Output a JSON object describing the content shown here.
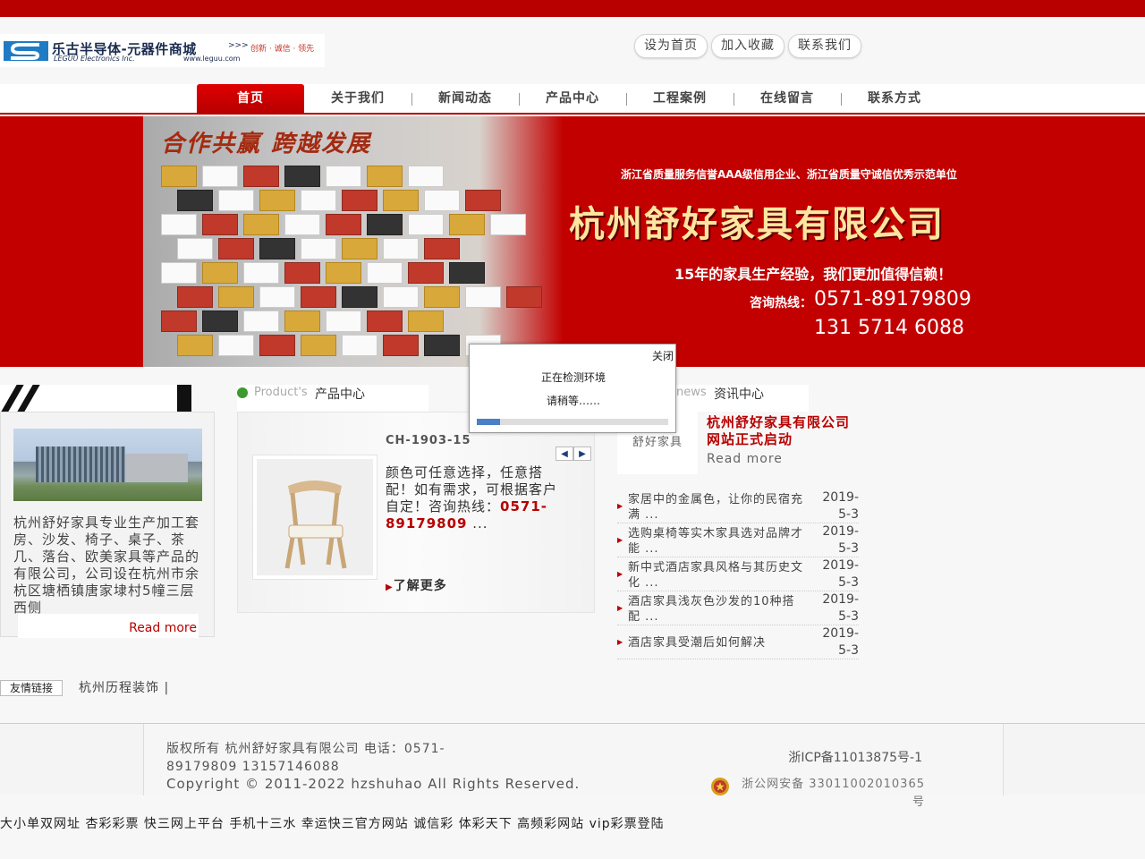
{
  "header": {
    "logo_name": "乐古半导体-元器件商城",
    "logo_arrows": ">>>",
    "logo_slogan": "创新 · 诚信 · 领先",
    "logo_sub": "LEGUU Electronics Inc.",
    "logo_url": "www.leguu.com",
    "links": [
      "设为首页",
      "加入收藏",
      "联系我们"
    ]
  },
  "nav": {
    "items": [
      "首页",
      "关于我们",
      "新闻动态",
      "产品中心",
      "工程案例",
      "在线留言",
      "联系方式"
    ],
    "active": "首页"
  },
  "banner": {
    "motto": "合作共赢 跨越发展",
    "cert": "浙江省质量服务信誉AAA级信用企业、浙江省质量守诚信优秀示范单位",
    "company": "杭州舒好家具有限公司",
    "experience": "15年的家具生产经验，我们更加值得信赖！",
    "hotline_label": "咨询热线：",
    "tel1": "0571-89179809",
    "tel2": "131 5714 6088"
  },
  "about": {
    "text": "杭州舒好家具专业生产加工套房、沙发、椅子、桌子、茶几、落台、欧美家具等产品的有限公司，公司设在杭州市余杭区塘栖镇唐家埭村5幢三层西侧",
    "more": "Read more"
  },
  "products": {
    "title_en": "Product's",
    "title_cn": "产品中心",
    "code": "CH-1903-15",
    "desc_plain": "颜色可任意选择，任意搭配！如有需求，可根据客户自定！咨询热线：",
    "desc_tel": "0571-89179809",
    "desc_ellipsis": " ...",
    "learn_more": "了解更多",
    "prev": "◀",
    "next": "▶"
  },
  "news": {
    "title_en": "news",
    "title_cn": "资讯中心",
    "badge": "舒好家具",
    "headline": "杭州舒好家具有限公司网站正式启动",
    "more": "Read more",
    "items": [
      {
        "title": "家居中的金属色，让你的民宿充满 ...",
        "date": "2019-5-3"
      },
      {
        "title": "选购桌椅等实木家具选对品牌才能 ...",
        "date": "2019-5-3"
      },
      {
        "title": "新中式酒店家具风格与其历史文化 ...",
        "date": "2019-5-3"
      },
      {
        "title": "酒店家具浅灰色沙发的10种搭配 ...",
        "date": "2019-5-3"
      },
      {
        "title": "酒店家具受潮后如何解决",
        "date": "2019-5-3"
      }
    ]
  },
  "friend_links": {
    "label": "友情链接",
    "text": "杭州历程装饰 |"
  },
  "footer": {
    "copy1": "版权所有 杭州舒好家具有限公司  电话：0571-89179809  13157146088",
    "copy2": "Copyright © 2011-2022 hzshuhao All Rights Reserved.",
    "icp": "浙ICP备11013875号-1",
    "gongan": "浙公网安备 33011002010365号"
  },
  "spam_links": "大小单双网址 杏彩彩票 快三网上平台 手机十三水 幸运快三官方网站 诚信彩 体彩天下 高频彩网站 vip彩票登陆",
  "popup": {
    "close": "关闭",
    "line1": "正在检测环境",
    "line2": "请稍等……",
    "progress": 0.12
  },
  "colors": {
    "brand_red": "#b80000",
    "banner_red": "#c20000",
    "accent_green": "#3c9a2f",
    "progress_blue": "#4a80c8"
  }
}
